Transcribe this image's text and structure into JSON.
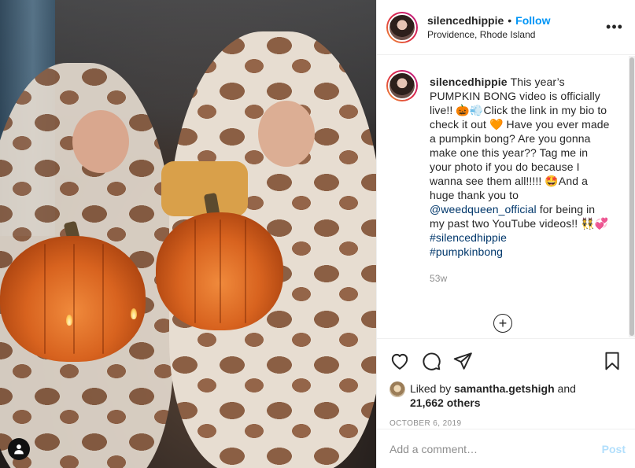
{
  "header": {
    "username": "silencedhippie",
    "separator": "•",
    "follow_label": "Follow",
    "location": "Providence, Rhode Island",
    "more_label": "•••"
  },
  "caption": {
    "username": "silencedhippie",
    "text_part1": "This year’s PUMPKIN BONG video is officially live!! 🎃💨Click the link in my bio to check it out 🧡 Have you ever made a pumpkin bong? Are you gonna make one this year?? Tag me in your photo if you do because I wanna see them all!!!!! 🤩And a huge thank you to ",
    "mention": "@weedqueen_official",
    "text_part2": " for being in my past two YouTube videos!! 👯💞",
    "hashtag1": "#silencedhippie",
    "hashtag2": "#pumpkinbong",
    "time_ago": "53w"
  },
  "load_more_symbol": "+",
  "likes": {
    "liked_by_prefix": "Liked by ",
    "liked_by_user": "samantha.getshigh",
    "and": " and",
    "others": "21,662 others"
  },
  "post_date": "OCTOBER 6, 2019",
  "comment_box": {
    "placeholder": "Add a comment…",
    "post_label": "Post"
  },
  "colors": {
    "follow_blue": "#0095f6",
    "post_disabled_blue": "#b2dffc",
    "link_blue": "#00376b",
    "muted_gray": "#8e8e8e"
  },
  "icons": [
    "heart-icon",
    "comment-icon",
    "share-icon",
    "bookmark-icon",
    "user-tag-icon",
    "plus-circle-icon"
  ]
}
